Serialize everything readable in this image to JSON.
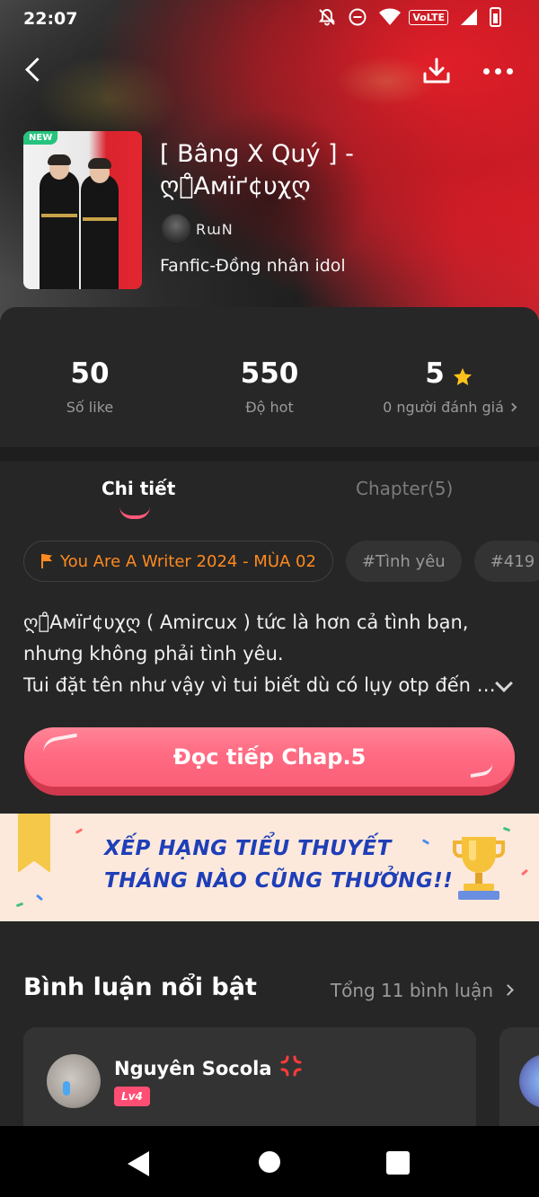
{
  "status_bar": {
    "time": "22:07",
    "volte_label": "VoLTE"
  },
  "icons": {
    "back": "back-arrow-icon",
    "download": "download-icon",
    "more": "more-dots-icon",
    "star": "star-icon",
    "flag": "flag-icon",
    "expand": "chevron-down-icon",
    "chevron_right": "chevron-right-icon",
    "anger": "anger-emoji-icon"
  },
  "story": {
    "new_badge": "NEW",
    "title": "[ Bâng X Quý ] - ღঌ̊Aмїґ¢υχღ",
    "author": "RɯN",
    "genre": "Fanfic-Đồng nhân idol"
  },
  "stats": {
    "likes_value": "50",
    "likes_label": "Số like",
    "hot_value": "550",
    "hot_label": "Độ hot",
    "rating_value": "5",
    "rating_label": "0 người đánh giá"
  },
  "tabs": {
    "detail": "Chi tiết",
    "chapters": "Chapter(5)"
  },
  "tags": [
    {
      "label": "You Are A Writer 2024 - MÙA 02"
    },
    {
      "label": "#Tình yêu"
    },
    {
      "label": "#419"
    }
  ],
  "description": {
    "line1": "ღঌ̊Aмїґ¢υχღ ( Amircux ) tức là hơn cả tình bạn,",
    "line2": "nhưng không phải tình yêu.",
    "line3": "Tui đặt tên như vậy vì tui biết dù có lụy otp đến c..."
  },
  "read_button": {
    "label": "Đọc tiếp Chap.5"
  },
  "banner": {
    "line1": "XẾP HẠNG TIỂU THUYẾT",
    "line2": "THÁNG NÀO CŨNG THƯỞNG!!"
  },
  "comments": {
    "heading": "Bình luận nổi bật",
    "total": "Tổng 11 bình luận",
    "items": [
      {
        "name": "Nguyên Socola",
        "level": "Lv4"
      }
    ]
  },
  "colors": {
    "accent_pink": "#ff6b82",
    "event_orange": "#ff8a1f",
    "banner_blue": "#1f3fb8",
    "star_yellow": "#ffc21a",
    "level_pink": "#ff4e74"
  }
}
